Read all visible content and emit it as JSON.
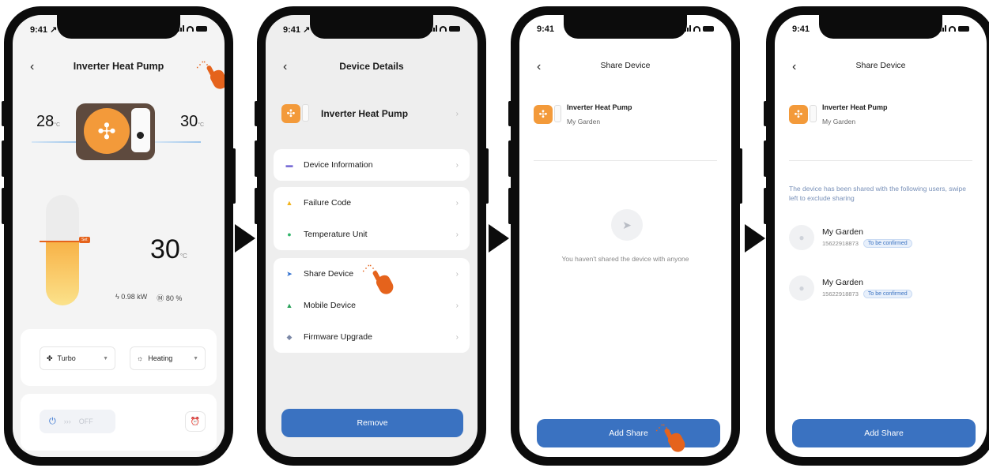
{
  "status": {
    "time_1": "9:41 ↗",
    "time_2": "9:41 ↗",
    "time_3": "9:41",
    "time_4": "9:41"
  },
  "screen1": {
    "title": "Inverter Heat Pump",
    "back": "‹",
    "outdoor_temp": "28",
    "outdoor_unit": "°C",
    "water_temp": "30",
    "water_unit": "°C",
    "set_badge": "Set",
    "current_temp": "30",
    "current_unit": "°C",
    "power": "0.98 kW",
    "percent": "80 %",
    "power_icon": "bolt-icon",
    "percent_icon": "meter-icon",
    "level_fraction": 0.58,
    "mode_fan": "Turbo",
    "mode_heat": "Heating",
    "power_state": "OFF",
    "power_arrows": "›››"
  },
  "screen2": {
    "title": "Device Details",
    "back": "‹",
    "device_name": "Inverter Heat Pump",
    "items": [
      {
        "label": "Device Information",
        "icon": "info-icon",
        "color": "#7b6fd6",
        "glyph": "▬"
      },
      {
        "label": "Failure Code",
        "icon": "warning-icon",
        "color": "#f2b31b",
        "glyph": "▲"
      },
      {
        "label": "Temperature Unit",
        "icon": "thermometer-icon",
        "color": "#31b56a",
        "glyph": "●"
      },
      {
        "label": "Share Device",
        "icon": "send-icon",
        "color": "#2f6fcf",
        "glyph": "➤"
      },
      {
        "label": "Mobile Device",
        "icon": "mobile-icon",
        "color": "#2aa15a",
        "glyph": "▲"
      },
      {
        "label": "Firmware Upgrade",
        "icon": "upgrade-icon",
        "color": "#7b88a6",
        "glyph": "◆"
      }
    ],
    "remove": "Remove"
  },
  "screen3": {
    "title": "Share Device",
    "back": "‹",
    "device_name": "Inverter Heat Pump",
    "location": "My Garden",
    "empty_text": "You haven't shared the device with anyone",
    "add_share": "Add Share"
  },
  "screen4": {
    "title": "Share Device",
    "back": "‹",
    "device_name": "Inverter Heat Pump",
    "location": "My Garden",
    "info": "The device has been shared with the following users, swipe left to exclude sharing",
    "users": [
      {
        "name": "My Garden",
        "phone": "15622918873",
        "status": "To be confirmed"
      },
      {
        "name": "My Garden",
        "phone": "15622918873",
        "status": "To be confirmed"
      }
    ],
    "add_share": "Add Share"
  },
  "colors": {
    "accent": "#3a72c1",
    "pointer": "#e5631c",
    "heat": "#f39a3a"
  }
}
